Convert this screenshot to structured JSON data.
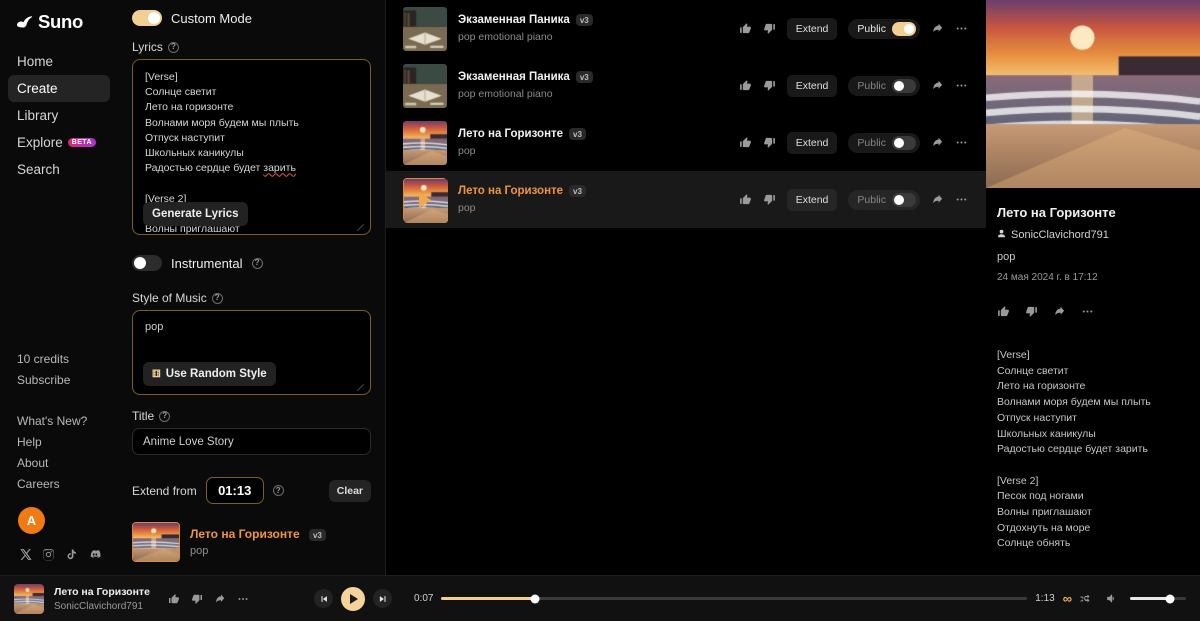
{
  "brand": {
    "name": "Suno",
    "logo_icon": "music-note-icon"
  },
  "sidebar": {
    "nav": [
      {
        "label": "Home",
        "icon": "home-icon",
        "active": false
      },
      {
        "label": "Create",
        "icon": "create-icon",
        "active": true
      },
      {
        "label": "Library",
        "icon": "library-icon",
        "active": false
      },
      {
        "label": "Explore",
        "icon": "compass-icon",
        "active": false,
        "badge": "BETA"
      },
      {
        "label": "Search",
        "icon": "search-icon",
        "active": false
      }
    ],
    "credits": "10 credits",
    "subscribe": "Subscribe",
    "links": [
      "What's New?",
      "Help",
      "About",
      "Careers"
    ],
    "avatar_initial": "A",
    "socials": [
      "x-icon",
      "instagram-icon",
      "tiktok-icon",
      "discord-icon"
    ]
  },
  "create": {
    "custom_mode_label": "Custom Mode",
    "custom_mode_on": true,
    "lyrics_label": "Lyrics",
    "lyrics_value": "[Verse]\nСолнце светит\nЛето на горизонте\nВолнами моря будем мы плыть\nОтпуск наступит\nШкольных каникулы\nРадостью сердце будет ",
    "lyrics_misspelled": "зарить",
    "lyrics_value_cont": "\n\n[Verse 2]\nПесок под ногами\nВолны приглашают",
    "generate_lyrics_label": "Generate Lyrics",
    "instrumental_label": "Instrumental",
    "instrumental_on": false,
    "style_label": "Style of Music",
    "style_value": "pop",
    "random_style_label": "Use Random Style",
    "random_style_icon": "dice-icon",
    "title_label": "Title",
    "title_value": "Anime Love Story",
    "extend_from_label": "Extend from",
    "extend_from_time": "01:13",
    "clear_label": "Clear",
    "extend_card": {
      "title": "Лето на Горизонте",
      "version": "v3",
      "style": "pop"
    }
  },
  "songs": [
    {
      "title": "Экзаменная Паника",
      "version": "v3",
      "style": "pop emotional piano",
      "extend_label": "Extend",
      "public_label": "Public",
      "public_on": true,
      "active": false,
      "art": "library-desk"
    },
    {
      "title": "Экзаменная Паника",
      "version": "v3",
      "style": "pop emotional piano",
      "extend_label": "Extend",
      "public_label": "Public",
      "public_on": false,
      "active": false,
      "art": "library-desk"
    },
    {
      "title": "Лето на Горизонте",
      "version": "v3",
      "style": "pop",
      "extend_label": "Extend",
      "public_label": "Public",
      "public_on": false,
      "active": false,
      "art": "sunset-beach"
    },
    {
      "title": "Лето на Горизонте",
      "version": "v3",
      "style": "pop",
      "extend_label": "Extend",
      "public_label": "Public",
      "public_on": false,
      "active": true,
      "art": "sunset-beach"
    }
  ],
  "detail": {
    "title": "Лето на Горизонте",
    "user": "SonicClavichord791",
    "style": "pop",
    "date": "24 мая 2024 г. в 17:12",
    "lyrics": "[Verse]\nСолнце светит\nЛето на горизонте\nВолнами моря будем мы плыть\nОтпуск наступит\nШкольных каникулы\nРадостью сердце будет зарить\n\n[Verse 2]\nПесок под ногами\nВолны приглашают\nОтдохнуть на море\nСолнце обнять"
  },
  "player": {
    "title": "Лето на Горизонте",
    "user": "SonicClavichord791",
    "current_time": "0:07",
    "total_time": "1:13",
    "progress_percent": 16,
    "volume_percent": 72,
    "infinity_icon": "infinity-icon",
    "shuffle_icon": "shuffle-icon",
    "prev_icon": "previous-icon",
    "play_icon": "play-icon",
    "next_icon": "next-icon",
    "volume_icon": "speaker-icon"
  },
  "colors": {
    "accent": "#f2cf92",
    "orange": "#f09440",
    "avatar": "#f07a13"
  }
}
